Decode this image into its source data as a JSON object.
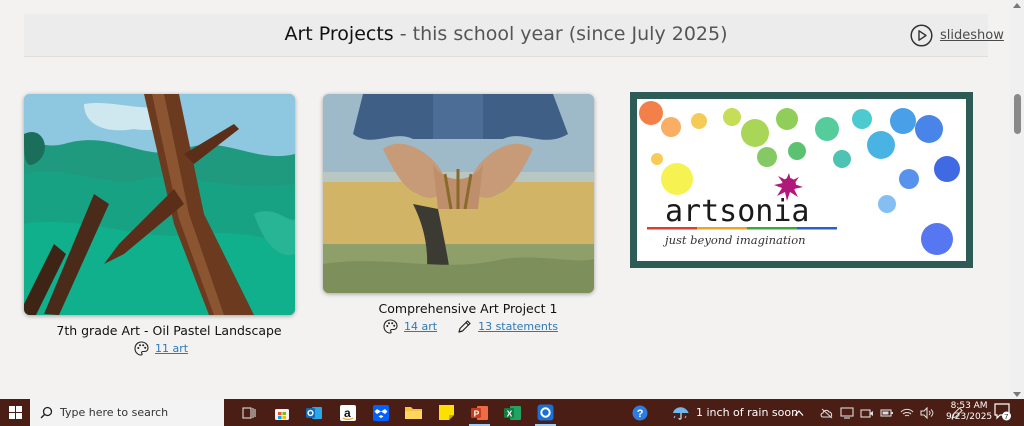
{
  "header": {
    "title_main": "Art Projects",
    "title_sub": " - this school year (since July 2025)",
    "slideshow_label": "slideshow"
  },
  "cards": [
    {
      "title": "7th grade Art - Oil Pastel Landscape",
      "art_count": "11 art"
    },
    {
      "title": "Comprehensive Art Project 1",
      "art_count": "14 art",
      "statements_count": "13 statements"
    },
    {
      "logo_word": "artsonia",
      "logo_tagline": "just beyond imagination"
    }
  ],
  "taskbar": {
    "search_placeholder": "Type here to search",
    "weather": "1 inch of rain soon",
    "time": "8:53 AM",
    "date": "9/23/2025",
    "notification_count": "7",
    "apps": [
      "task-view-icon",
      "store-icon",
      "outlook-icon",
      "amazon-icon",
      "dropbox-icon",
      "file-explorer-icon",
      "sticky-notes-icon",
      "powerpoint-icon",
      "excel-icon",
      "browser-icon"
    ]
  },
  "colors": {
    "accent_link": "#2a7ab8",
    "taskbar": "#4a1e14",
    "logo_frame": "#2c5c55"
  }
}
